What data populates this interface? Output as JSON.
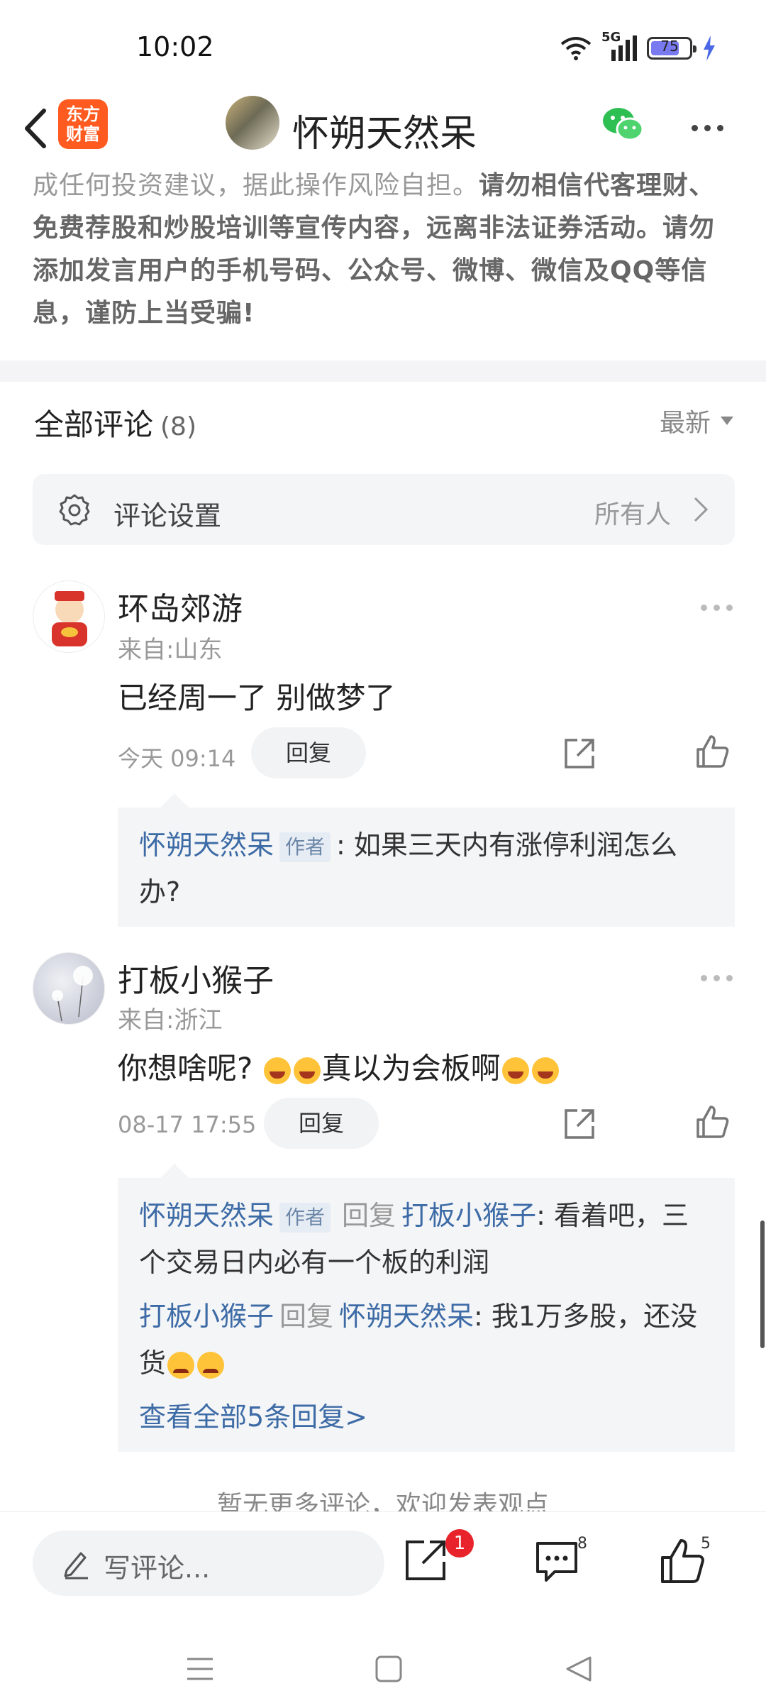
{
  "status_bar": {
    "time": "10:02",
    "network": "5G",
    "battery": "75"
  },
  "nav": {
    "app_logo_line1": "东方",
    "app_logo_line2": "财富",
    "author_name": "怀朔天然呆"
  },
  "disclaimer": {
    "text_gray": "成任何投资建议，据此操作风险自担。",
    "text_bold": "请勿相信代客理财、免费荐股和炒股培训等宣传内容，远离非法证券活动。请勿添加发言用户的手机号码、公众号、微博、微信及QQ等信息，谨防上当受骗!"
  },
  "comments_header": {
    "title": "全部评论",
    "count": "(8)",
    "sort_label": "最新"
  },
  "settings": {
    "label": "评论设置",
    "value": "所有人"
  },
  "comments": [
    {
      "name": "环岛郊游",
      "location": "来自:山东",
      "text": "已经周一了 别做梦了",
      "time": "今天 09:14",
      "reply_label": "回复",
      "replies": [
        {
          "author": "怀朔天然呆",
          "tag": "作者",
          "text": ": 如果三天内有涨停利润怎么办?"
        }
      ]
    },
    {
      "name": "打板小猴子",
      "location": "来自:浙江",
      "text_part1": "你想啥呢?",
      "text_part2": "真以为会板啊",
      "time": "08-17 17:55",
      "reply_label": "回复",
      "replies": [
        {
          "author": "怀朔天然呆",
          "tag": "作者",
          "reply_word": "回复",
          "target": "打板小猴子",
          "text": ": 看着吧，三个交易日内必有一个板的利润"
        },
        {
          "author": "打板小猴子",
          "reply_word": "回复",
          "target": "怀朔天然呆",
          "text": ": 我1万多股，还没货"
        }
      ],
      "view_all": "查看全部5条回复>"
    }
  ],
  "no_more_text": "暂无更多评论，欢迎发表观点",
  "bottom_bar": {
    "input_placeholder": "写评论...",
    "share_badge": "1",
    "comment_count": "8",
    "like_count": "5"
  }
}
